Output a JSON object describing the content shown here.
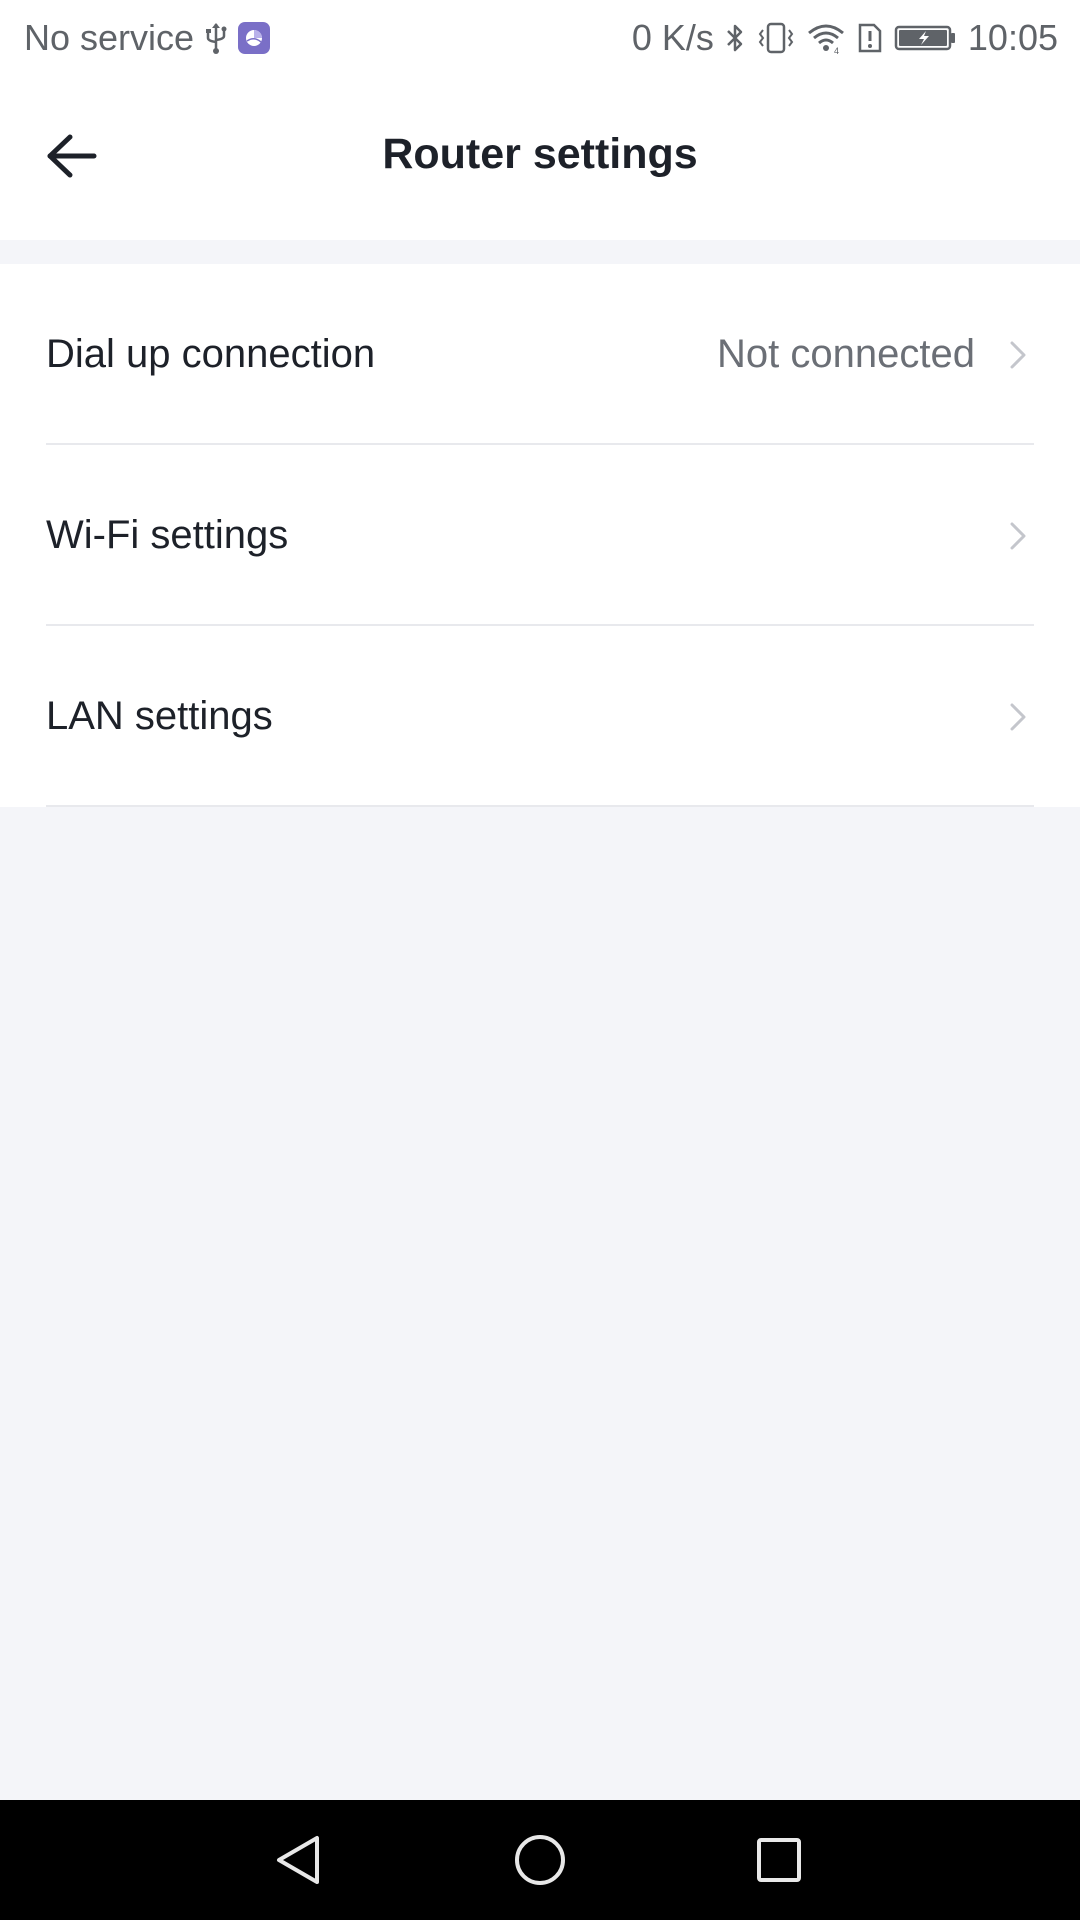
{
  "status_bar": {
    "carrier": "No service",
    "net_speed": "0 K/s",
    "time": "10:05",
    "icons_left": [
      "usb-icon",
      "app-notification-icon"
    ],
    "icons_right": [
      "bluetooth-icon",
      "vibrate-icon",
      "wifi-icon",
      "sim-alert-icon",
      "battery-charging-icon"
    ]
  },
  "header": {
    "title": "Router settings",
    "back_icon": "arrow-left-icon"
  },
  "settings": {
    "items": [
      {
        "label": "Dial up connection",
        "value": "Not connected"
      },
      {
        "label": "Wi-Fi settings",
        "value": ""
      },
      {
        "label": "LAN settings",
        "value": ""
      }
    ]
  },
  "nav_bar": {
    "icons": [
      "back-triangle-icon",
      "home-circle-icon",
      "recents-square-icon"
    ]
  },
  "colors": {
    "background": "#f4f5f9",
    "surface": "#ffffff",
    "text_primary": "#1d2129",
    "text_secondary": "#6b6f76",
    "divider": "#e8e9ed",
    "chevron": "#c4c6cc"
  }
}
